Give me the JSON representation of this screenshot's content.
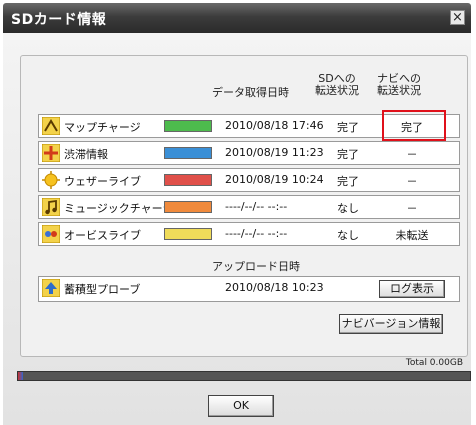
{
  "window": {
    "title": "SDカード情報",
    "close_glyph": "×"
  },
  "headers": {
    "date": "データ取得日時",
    "sd_line1": "SDへの",
    "sd_line2": "転送状況",
    "navi_line1": "ナビへの",
    "navi_line2": "転送状況"
  },
  "rows": [
    {
      "icon": "map-charge-icon",
      "name": "マップチャージ",
      "swatch": "#4dbb4d",
      "date": "2010/08/18 17:46",
      "sd": "完了",
      "navi": "完了"
    },
    {
      "icon": "traffic-icon",
      "name": "渋滞情報",
      "swatch": "#3a8fd6",
      "date": "2010/08/19 11:23",
      "sd": "完了",
      "navi": "－"
    },
    {
      "icon": "weather-icon",
      "name": "ウェザーライブ",
      "swatch": "#e0504a",
      "date": "2010/08/19 10:24",
      "sd": "完了",
      "navi": "－"
    },
    {
      "icon": "music-icon",
      "name": "ミュージックチャージ",
      "swatch": "#f08a3c",
      "date": "----/--/-- --:--",
      "sd": "なし",
      "navi": "－"
    },
    {
      "icon": "service-icon",
      "name": "オービスライブ",
      "swatch": "#f0dc5a",
      "date": "----/--/-- --:--",
      "sd": "なし",
      "navi": "未転送"
    }
  ],
  "upload": {
    "header": "アップロード日時",
    "name": "蓄積型プローブ",
    "date": "2010/08/18 10:23",
    "log_button": "ログ表示"
  },
  "navi_version_button": "ナビバージョン情報",
  "storage": {
    "total_label": "Total 0.00GB",
    "used_fraction": 0.01
  },
  "ok_button": "OK"
}
